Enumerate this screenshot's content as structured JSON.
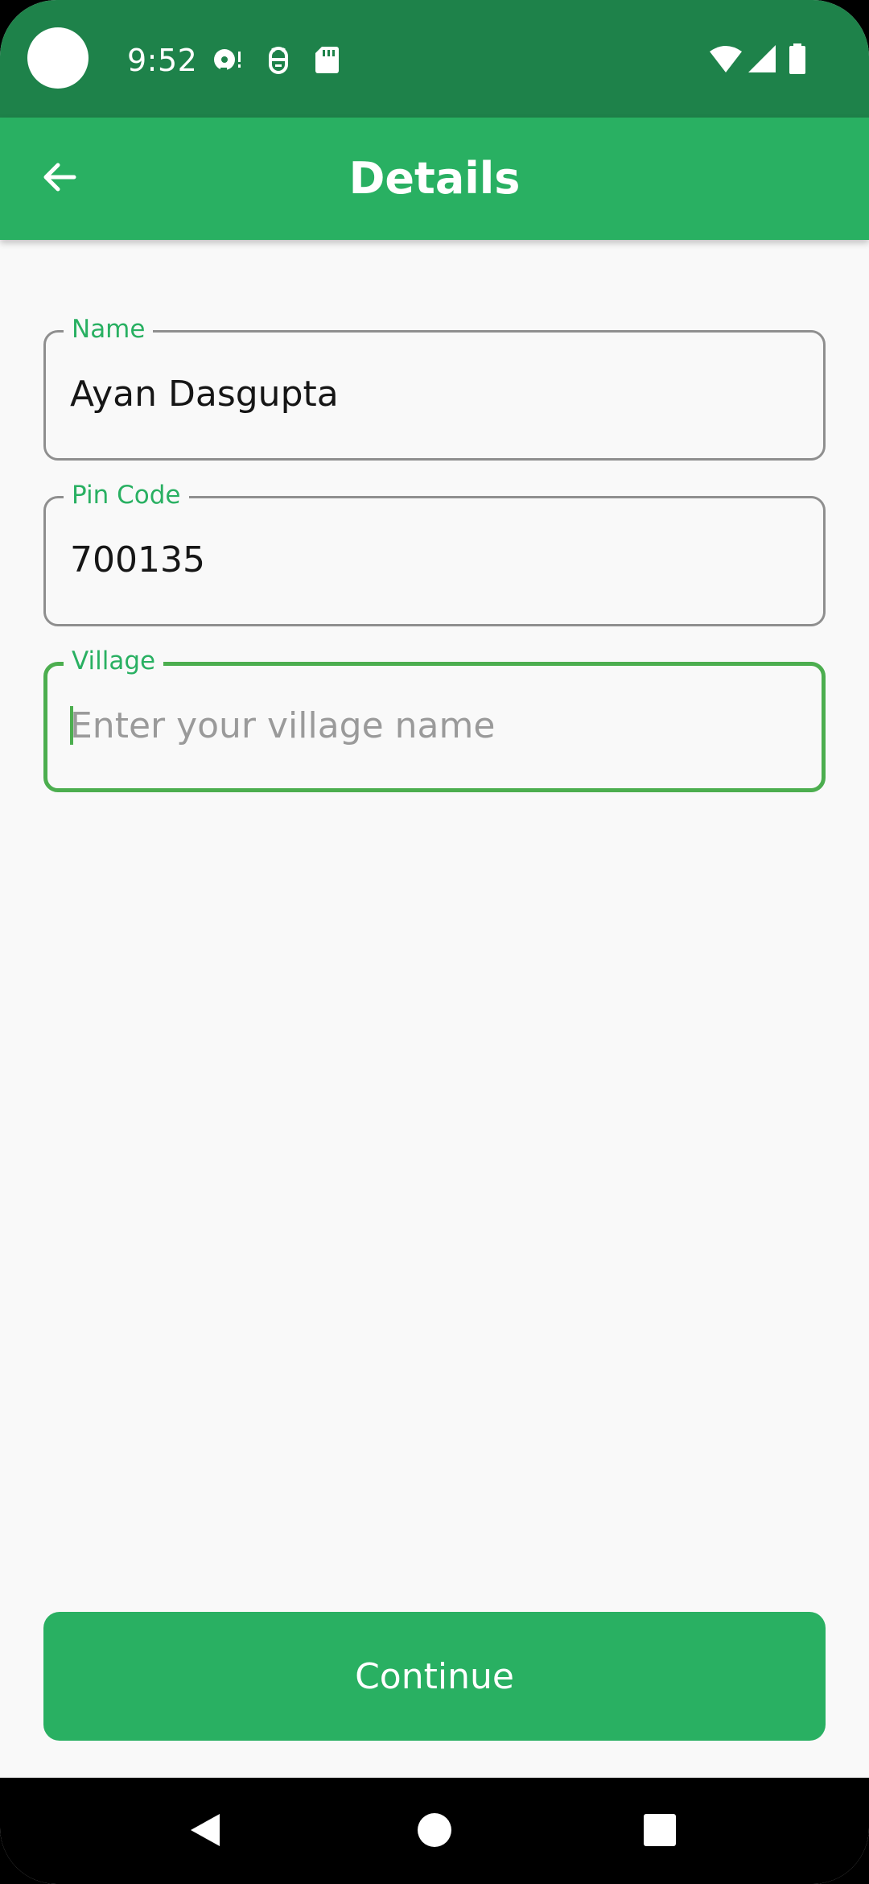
{
  "status_bar": {
    "time": "9:52",
    "background_color": "#1e824a",
    "left_icons": [
      "camera-cutout",
      "data-saver-icon",
      "debug-android-icon",
      "sd-card-icon"
    ],
    "right_icons": [
      "wifi-icon",
      "cellular-signal-icon",
      "battery-icon"
    ]
  },
  "app_bar": {
    "title": "Details",
    "back_icon": "arrow-left-icon",
    "background_color": "#29b062"
  },
  "form": {
    "name": {
      "label": "Name",
      "value": "Ayan Dasgupta"
    },
    "pin_code": {
      "label": "Pin Code",
      "value": "700135"
    },
    "village": {
      "label": "Village",
      "value": "",
      "placeholder": "Enter your village name",
      "focused": true
    }
  },
  "actions": {
    "continue_label": "Continue"
  },
  "nav_bar": {
    "buttons": [
      "back-triangle-icon",
      "home-circle-icon",
      "recents-square-icon"
    ]
  },
  "colors": {
    "accent": "#29b062",
    "focus_border": "#4cae4f",
    "field_border": "#8f8f8f",
    "page_background": "#f9f9f9"
  }
}
